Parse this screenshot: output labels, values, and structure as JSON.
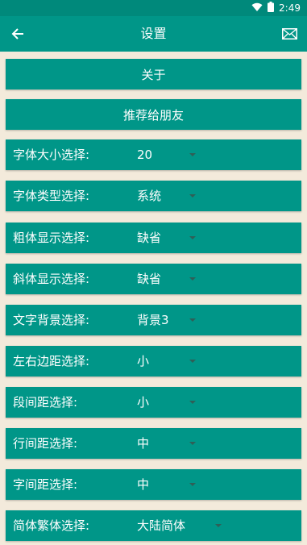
{
  "status_bar": {
    "time": "2:49"
  },
  "app_bar": {
    "title": "设置"
  },
  "buttons": {
    "about": "关于",
    "recommend": "推荐给朋友"
  },
  "settings": [
    {
      "label": "字体大小选择:",
      "value": "20"
    },
    {
      "label": "字体类型选择:",
      "value": "系统"
    },
    {
      "label": "粗体显示选择:",
      "value": "缺省"
    },
    {
      "label": "斜体显示选择:",
      "value": "缺省"
    },
    {
      "label": "文字背景选择:",
      "value": "背景3"
    },
    {
      "label": "左右边距选择:",
      "value": "小"
    },
    {
      "label": "段间距选择:",
      "value": "小"
    },
    {
      "label": "行间距选择:",
      "value": "中"
    },
    {
      "label": "字间距选择:",
      "value": "中"
    },
    {
      "label": "简体繁体选择:",
      "value": "大陆简体"
    }
  ],
  "colors": {
    "primary": "#009688",
    "status_bar": "#00897b",
    "background": "#f3eadb"
  },
  "icons": [
    "wifi-icon",
    "battery-icon",
    "back-arrow-icon",
    "mail-icon",
    "dropdown-arrow-icon"
  ]
}
